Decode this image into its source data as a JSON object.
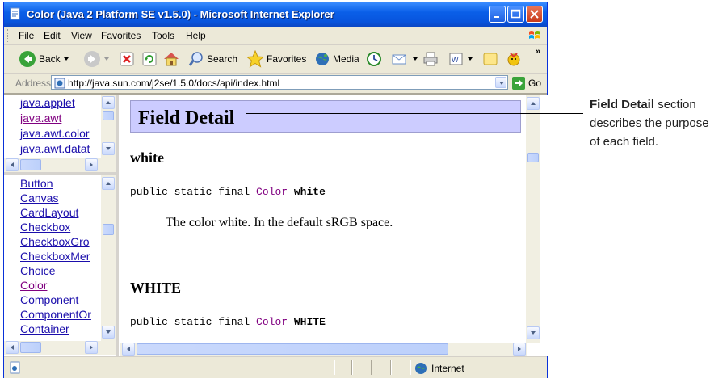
{
  "window": {
    "title": "Color (Java 2 Platform SE v1.5.0) - Microsoft Internet Explorer"
  },
  "menu": [
    "File",
    "Edit",
    "View",
    "Favorites",
    "Tools",
    "Help"
  ],
  "toolbar": {
    "back": "Back",
    "search": "Search",
    "favorites": "Favorites",
    "media": "Media"
  },
  "address": {
    "label": "Address",
    "url": "http://java.sun.com/j2se/1.5.0/docs/api/index.html",
    "go": "Go"
  },
  "packages": [
    "java.applet",
    "java.awt",
    "java.awt.color",
    "java.awt.datat"
  ],
  "classes": [
    "Button",
    "Canvas",
    "CardLayout",
    "Checkbox",
    "CheckboxGro",
    "CheckboxMer",
    "Choice",
    "Color",
    "Component",
    "ComponentOr",
    "Container"
  ],
  "main": {
    "section_title": "Field Detail",
    "fields": [
      {
        "name": "white",
        "sig_prefix": "public static final",
        "sig_type": "Color",
        "sig_name": "white",
        "description": "The color white. In the default sRGB space."
      },
      {
        "name": "WHITE",
        "sig_prefix": "public static final",
        "sig_type": "Color",
        "sig_name": "WHITE"
      }
    ]
  },
  "status": {
    "zone": "Internet"
  },
  "callout": {
    "bold": "Field Detail",
    "rest1": " section",
    "line2": "describes the purpose",
    "line3": "of each field."
  },
  "colors": {
    "title_bar": "#0854dd",
    "banner": "#ccccff",
    "link": "#1a0dab",
    "visited": "#800080"
  }
}
